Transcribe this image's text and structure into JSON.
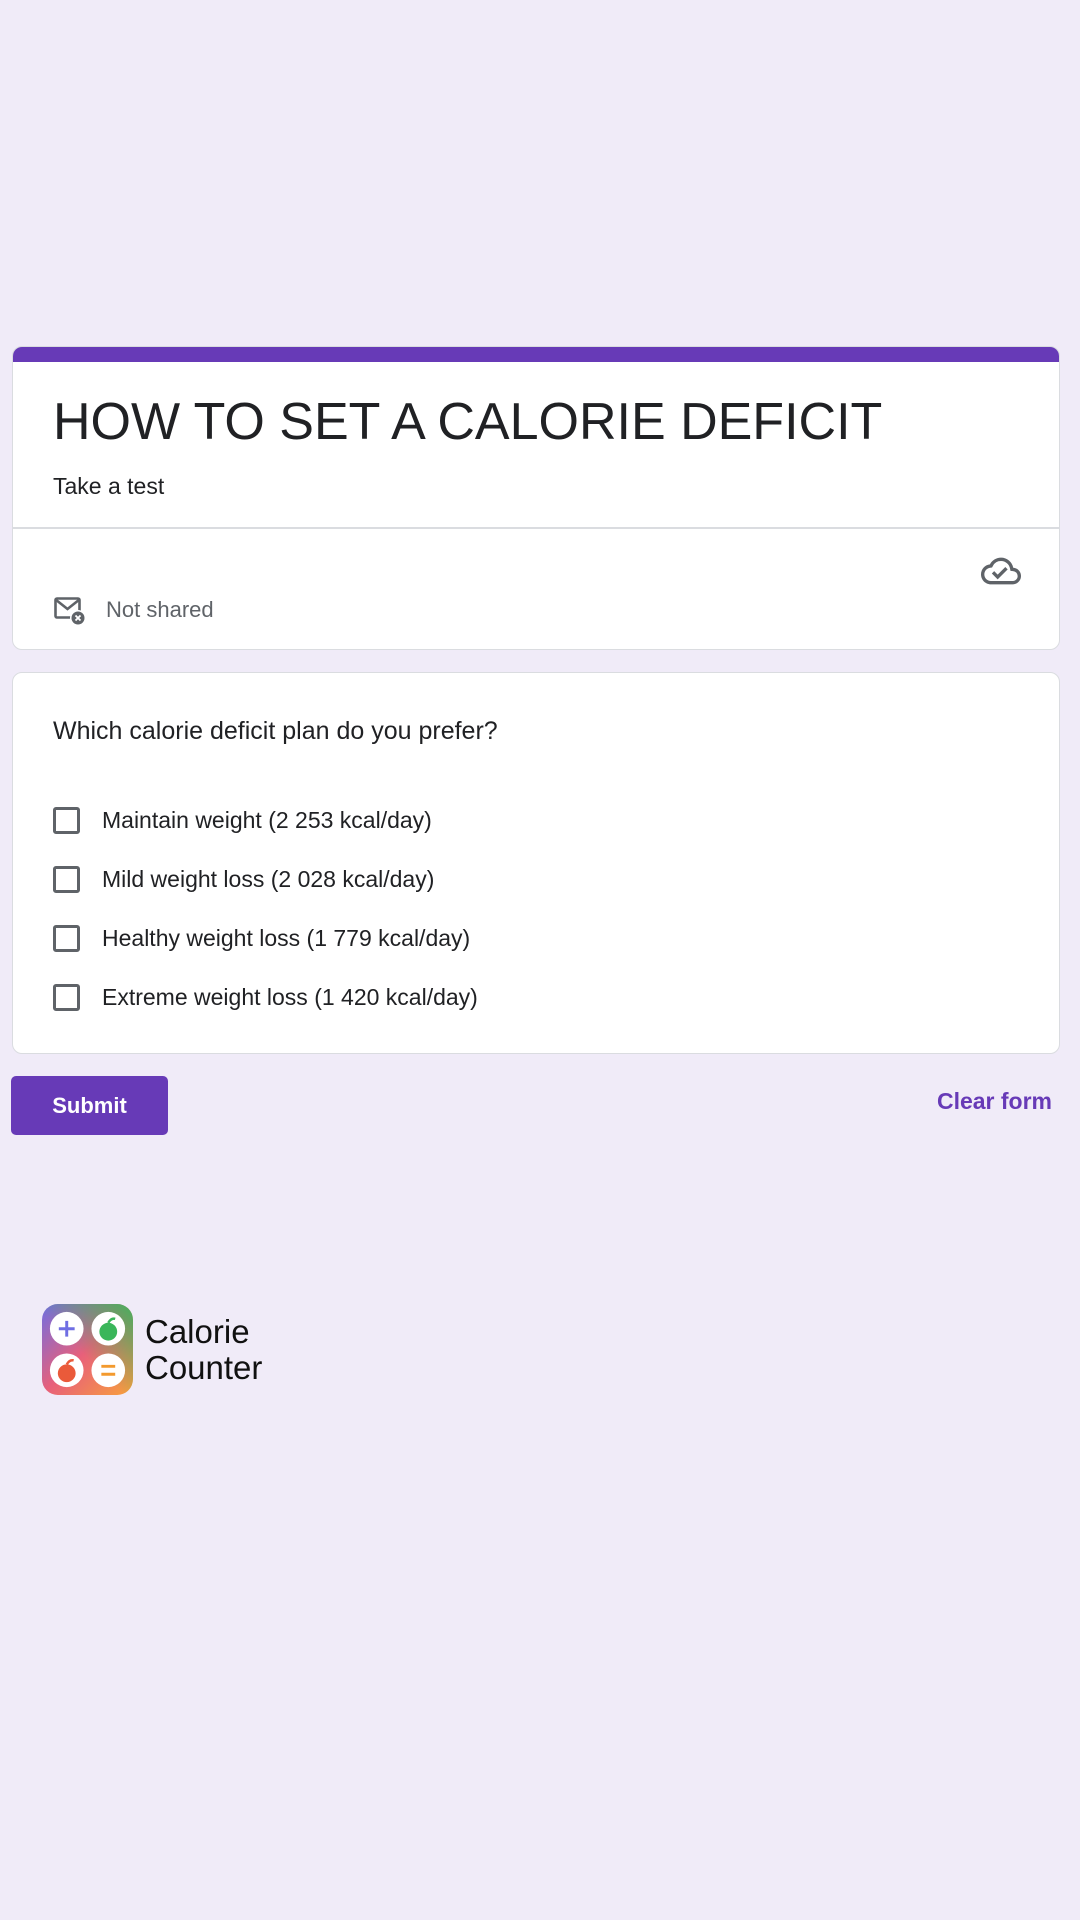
{
  "form": {
    "title": "HOW TO SET A CALORIE DEFICIT",
    "description": "Take a test",
    "sharing_status": "Not shared",
    "accent_color": "#673ab7",
    "background_color": "#f0ebf8"
  },
  "question": {
    "text": "Which calorie deficit plan do you prefer?",
    "options": [
      {
        "label": "Maintain weight (2 253 kcal/day)",
        "checked": false
      },
      {
        "label": "Mild weight loss (2 028 kcal/day)",
        "checked": false
      },
      {
        "label": "Healthy weight loss (1 779 kcal/day)",
        "checked": false
      },
      {
        "label": "Extreme weight loss (1 420 kcal/day)",
        "checked": false
      }
    ]
  },
  "actions": {
    "submit_label": "Submit",
    "clear_label": "Clear form"
  },
  "brand": {
    "name_line1": "Calorie",
    "name_line2": "Counter",
    "logo_icon": "calorie-counter-app-icon"
  }
}
